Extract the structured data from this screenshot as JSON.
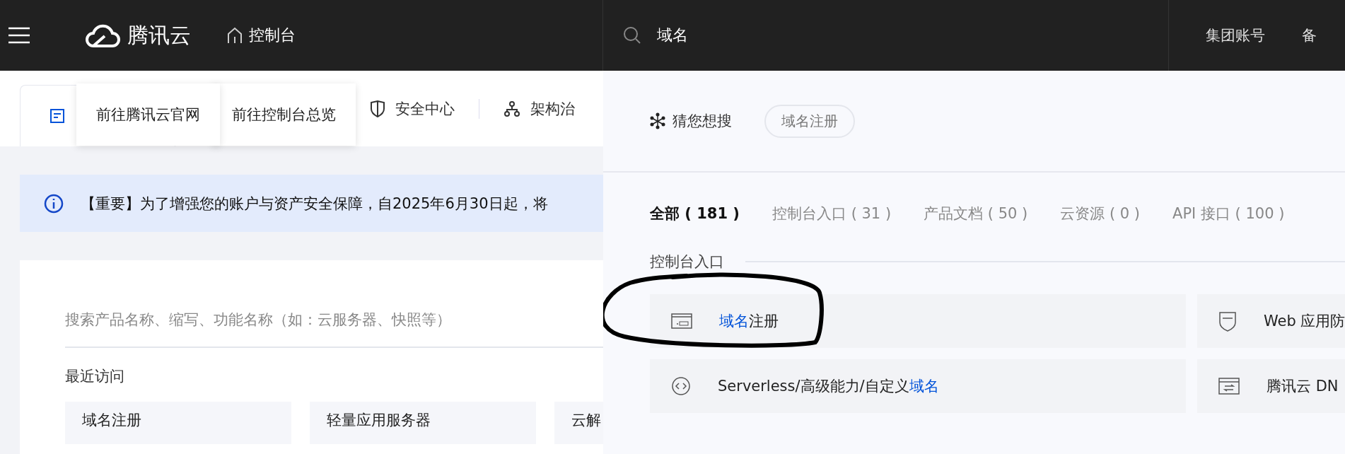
{
  "topbar": {
    "brand": "腾讯云",
    "console": "控制台",
    "search": {
      "value": "域名"
    },
    "links": [
      "集团账号",
      "备"
    ]
  },
  "nav_tabs": [
    {
      "label": "安全中心"
    },
    {
      "label": "架构治"
    }
  ],
  "tooltips": [
    "前往腾讯云官网",
    "前往控制台总览"
  ],
  "notice": "【重要】为了增强您的账户与资产安全保障，自2025年6月30日起，将",
  "product_search": {
    "placeholder": "搜索产品名称、缩写、功能名称（如：云服务器、快照等）"
  },
  "recent": {
    "title": "最近访问",
    "items": [
      "域名注册",
      "轻量应用服务器",
      "云解"
    ]
  },
  "dropdown": {
    "suggest_label": "猜您想搜",
    "suggestions": [
      "域名注册"
    ],
    "filters": [
      {
        "label": "全部 ( 181 )",
        "selected": true
      },
      {
        "label": "控制台入口 ( 31 )",
        "selected": false
      },
      {
        "label": "产品文档 ( 50 )",
        "selected": false
      },
      {
        "label": "云资源 ( 0 )",
        "selected": false
      },
      {
        "label": "API 接口 ( 100 )",
        "selected": false
      }
    ],
    "section": "控制台入口",
    "results": [
      {
        "kind": "com",
        "parts": [
          {
            "text": "域名",
            "highlight": true
          },
          {
            "text": "注册",
            "highlight": false
          }
        ]
      },
      {
        "kind": "waf",
        "parts": [
          {
            "text": "Web 应用防",
            "highlight": false
          }
        ]
      },
      {
        "kind": "code",
        "parts": [
          {
            "text": "Serverless/高级能力/自定义",
            "highlight": false
          },
          {
            "text": "域名",
            "highlight": true
          }
        ]
      },
      {
        "kind": "dns",
        "parts": [
          {
            "text": "腾讯云 DN",
            "highlight": false
          }
        ]
      }
    ]
  }
}
